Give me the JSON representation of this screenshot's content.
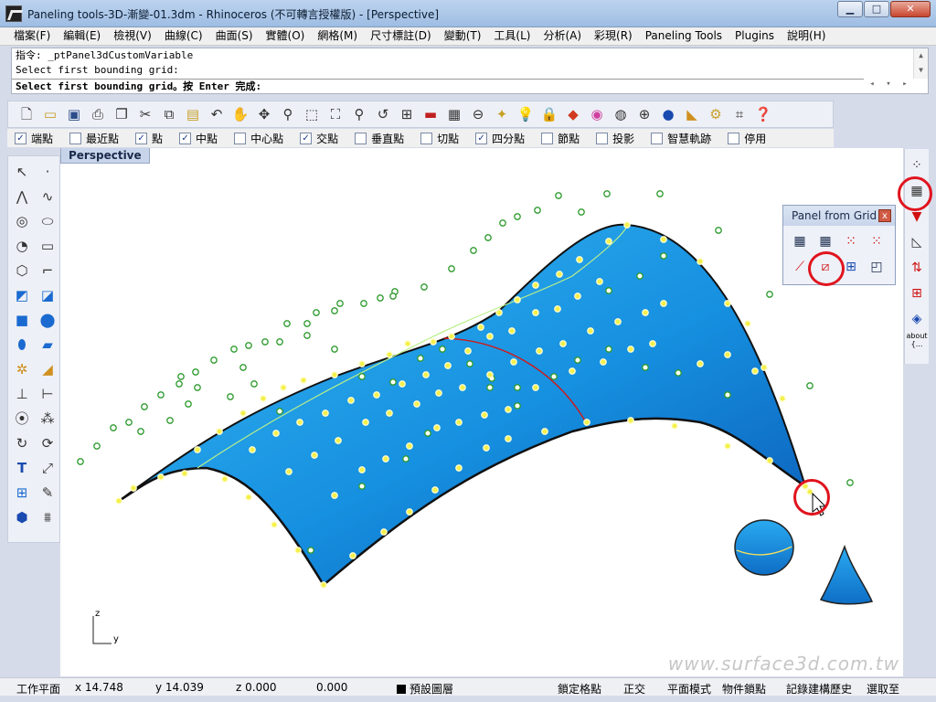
{
  "window": {
    "title": "Paneling tools-3D-漸變-01.3dm - Rhinoceros (不可轉言授權版) - [Perspective]",
    "buttons": {
      "minimize": "▁",
      "maximize": "□",
      "close": "✕"
    }
  },
  "menu": [
    "檔案(F)",
    "編輯(E)",
    "檢視(V)",
    "曲線(C)",
    "曲面(S)",
    "實體(O)",
    "網格(M)",
    "尺寸標註(D)",
    "變動(T)",
    "工具(L)",
    "分析(A)",
    "彩現(R)",
    "Paneling Tools",
    "Plugins",
    "說明(H)"
  ],
  "command": {
    "history": [
      "指令: _ptPanel3dCustomVariable",
      "Select first bounding grid:"
    ],
    "prompt": "Select first bounding grid。按 Enter 完成:"
  },
  "toolbar_icons": [
    "new-file-icon",
    "open-folder-icon",
    "save-icon",
    "print-icon",
    "import-icon",
    "cut-icon",
    "copy-icon",
    "paste-icon",
    "undo-icon",
    "pan-hand-icon",
    "rotate-view-icon",
    "zoom-icon",
    "zoom-window-icon",
    "zoom-extents-icon",
    "zoom-selected-icon",
    "undo-view-icon",
    "four-viewports-icon",
    "car-icon",
    "grid-icon",
    "cplane-icon",
    "point-light-icon",
    "light-bulb-icon",
    "lock-icon",
    "layer-icon",
    "color-wheel-icon",
    "wireframe-sphere-icon",
    "sphere-mesh-icon",
    "render-sphere-icon",
    "render-icon",
    "settings-gears-icon",
    "options-icon",
    "help-icon"
  ],
  "osnap": [
    {
      "label": "端點",
      "checked": true
    },
    {
      "label": "最近點",
      "checked": false
    },
    {
      "label": "點",
      "checked": true
    },
    {
      "label": "中點",
      "checked": true
    },
    {
      "label": "中心點",
      "checked": false
    },
    {
      "label": "交點",
      "checked": true
    },
    {
      "label": "垂直點",
      "checked": false
    },
    {
      "label": "切點",
      "checked": false
    },
    {
      "label": "四分點",
      "checked": true
    },
    {
      "label": "節點",
      "checked": false
    },
    {
      "label": "投影",
      "checked": false
    },
    {
      "label": "智慧軌跡",
      "checked": false
    },
    {
      "label": "停用",
      "checked": false
    }
  ],
  "viewport": {
    "label": "Perspective",
    "watermark": "www.surface3d.com.tw",
    "axis_z": "z",
    "axis_y": "y"
  },
  "panel": {
    "title": "Panel from Grid",
    "close": "x"
  },
  "right_toolbar": {
    "about_label": "about",
    "about_sub": "{..."
  },
  "status": {
    "cplane": "工作平面",
    "x": "x 14.748",
    "y": "y 14.039",
    "z": "z 0.000",
    "d": "0.000",
    "layer": "預設圖層",
    "snap": "鎖定格點",
    "ortho": "正交",
    "planar": "平面模式",
    "osnap": "物件鎖點",
    "history": "記錄建構歷史",
    "filter": "選取至"
  }
}
